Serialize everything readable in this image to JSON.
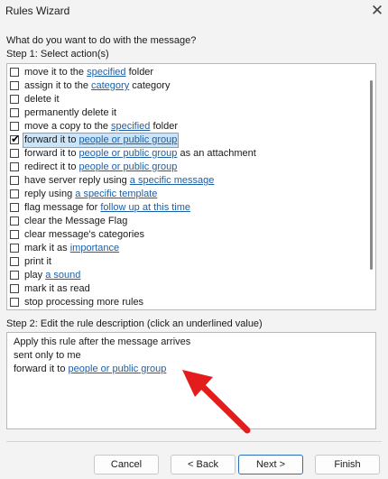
{
  "window": {
    "title": "Rules Wizard",
    "close_icon": "close-icon"
  },
  "question": "What do you want to do with the message?",
  "step1_label": "Step 1: Select action(s)",
  "actions": [
    {
      "parts": [
        [
          "t",
          "move it to the "
        ],
        [
          "l",
          "specified"
        ],
        [
          "t",
          " folder"
        ]
      ],
      "checked": false,
      "selected": false
    },
    {
      "parts": [
        [
          "t",
          "assign it to the "
        ],
        [
          "l",
          "category"
        ],
        [
          "t",
          " category"
        ]
      ],
      "checked": false,
      "selected": false
    },
    {
      "parts": [
        [
          "t",
          "delete it"
        ]
      ],
      "checked": false,
      "selected": false
    },
    {
      "parts": [
        [
          "t",
          "permanently delete it"
        ]
      ],
      "checked": false,
      "selected": false
    },
    {
      "parts": [
        [
          "t",
          "move a copy to the "
        ],
        [
          "l",
          "specified"
        ],
        [
          "t",
          " folder"
        ]
      ],
      "checked": false,
      "selected": false
    },
    {
      "parts": [
        [
          "t",
          "forward it to "
        ],
        [
          "l",
          "people or public group"
        ]
      ],
      "checked": true,
      "selected": true
    },
    {
      "parts": [
        [
          "t",
          "forward it to "
        ],
        [
          "l",
          "people or public group"
        ],
        [
          "t",
          " as an attachment"
        ]
      ],
      "checked": false,
      "selected": false
    },
    {
      "parts": [
        [
          "t",
          "redirect it to "
        ],
        [
          "l",
          "people or public group"
        ]
      ],
      "checked": false,
      "selected": false
    },
    {
      "parts": [
        [
          "t",
          "have server reply using "
        ],
        [
          "l",
          "a specific message"
        ]
      ],
      "checked": false,
      "selected": false
    },
    {
      "parts": [
        [
          "t",
          "reply using "
        ],
        [
          "l",
          "a specific template"
        ]
      ],
      "checked": false,
      "selected": false
    },
    {
      "parts": [
        [
          "t",
          "flag message for "
        ],
        [
          "l",
          "follow up at this time"
        ]
      ],
      "checked": false,
      "selected": false
    },
    {
      "parts": [
        [
          "t",
          "clear the Message Flag"
        ]
      ],
      "checked": false,
      "selected": false
    },
    {
      "parts": [
        [
          "t",
          "clear message's categories"
        ]
      ],
      "checked": false,
      "selected": false
    },
    {
      "parts": [
        [
          "t",
          "mark it as "
        ],
        [
          "l",
          "importance"
        ]
      ],
      "checked": false,
      "selected": false
    },
    {
      "parts": [
        [
          "t",
          "print it"
        ]
      ],
      "checked": false,
      "selected": false
    },
    {
      "parts": [
        [
          "t",
          "play "
        ],
        [
          "l",
          "a sound"
        ]
      ],
      "checked": false,
      "selected": false
    },
    {
      "parts": [
        [
          "t",
          "mark it as read"
        ]
      ],
      "checked": false,
      "selected": false
    },
    {
      "parts": [
        [
          "t",
          "stop processing more rules"
        ]
      ],
      "checked": false,
      "selected": false
    }
  ],
  "step2_label": "Step 2: Edit the rule description (click an underlined value)",
  "description": [
    [
      [
        "t",
        "Apply this rule after the message arrives"
      ]
    ],
    [
      [
        "t",
        "sent only to me"
      ]
    ],
    [
      [
        "t",
        "forward it to "
      ],
      [
        "l",
        "people or public group"
      ]
    ]
  ],
  "buttons": {
    "cancel": "Cancel",
    "back": "< Back",
    "next": "Next >",
    "finish": "Finish"
  },
  "colors": {
    "link": "#1d5fa6",
    "selection": "#cce4f7",
    "arrow": "#e31c1c",
    "primary_border": "#2a6fbd"
  }
}
